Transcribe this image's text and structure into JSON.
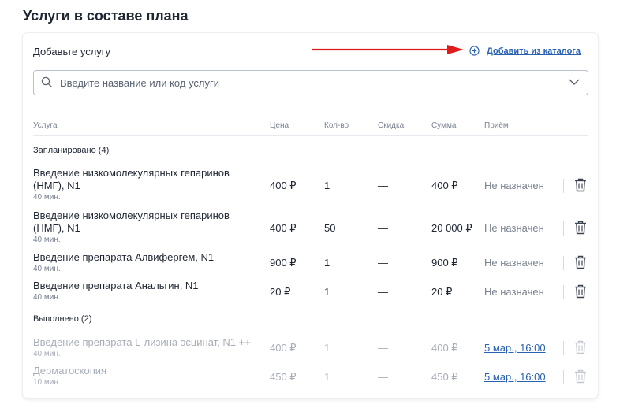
{
  "page": {
    "title": "Услуги в составе плана"
  },
  "card": {
    "add_label": "Добавьте услугу",
    "catalog_link": "Добавить из каталога",
    "search": {
      "placeholder": "Введите название или код услуги"
    },
    "columns": {
      "service": "Услуга",
      "price": "Цена",
      "qty": "Кол-во",
      "discount": "Скидка",
      "sum": "Сумма",
      "appointment": "Приём"
    },
    "groups": {
      "planned": "Запланировано (4)",
      "done": "Выполнено (2)"
    },
    "planned_rows": [
      {
        "name": "Введение низкомолекулярных гепаринов (НМГ), N1",
        "duration": "40 мин.",
        "price": "400 ₽",
        "qty": "1",
        "discount": "—",
        "sum": "400 ₽",
        "status": "Не назначен"
      },
      {
        "name": "Введение низкомолекулярных гепаринов (НМГ), N1",
        "duration": "40 мин.",
        "price": "400 ₽",
        "qty": "50",
        "discount": "—",
        "sum": "20 000 ₽",
        "status": "Не назначен"
      },
      {
        "name": "Введение препарата Алвифергем, N1",
        "duration": "40 мин.",
        "price": "900 ₽",
        "qty": "1",
        "discount": "—",
        "sum": "900 ₽",
        "status": "Не назначен"
      },
      {
        "name": "Введение препарата Анальгин, N1",
        "duration": "40 мин.",
        "price": "20 ₽",
        "qty": "1",
        "discount": "—",
        "sum": "20 ₽",
        "status": "Не назначен"
      }
    ],
    "done_rows": [
      {
        "name": "Введение препарата L-лизина эсцинат, N1 ++",
        "duration": "40 мин.",
        "price": "400 ₽",
        "qty": "1",
        "discount": "—",
        "sum": "400 ₽",
        "status": "5 мар., 16:00"
      },
      {
        "name": "Дерматоскопия",
        "duration": "10 мин.",
        "price": "450 ₽",
        "qty": "1",
        "discount": "—",
        "sum": "450 ₽",
        "status": "5 мар., 16:00"
      }
    ]
  },
  "colors": {
    "accent": "#2a62b3",
    "arrow": "#e01b1b",
    "muted_text": "#7b8390",
    "done_text": "#a8aeb8"
  },
  "icons": {
    "search": "search-icon",
    "dropdown": "chevron-down-icon",
    "add": "plus-circle-icon",
    "delete": "trash-icon",
    "pointer": "red-arrow"
  }
}
